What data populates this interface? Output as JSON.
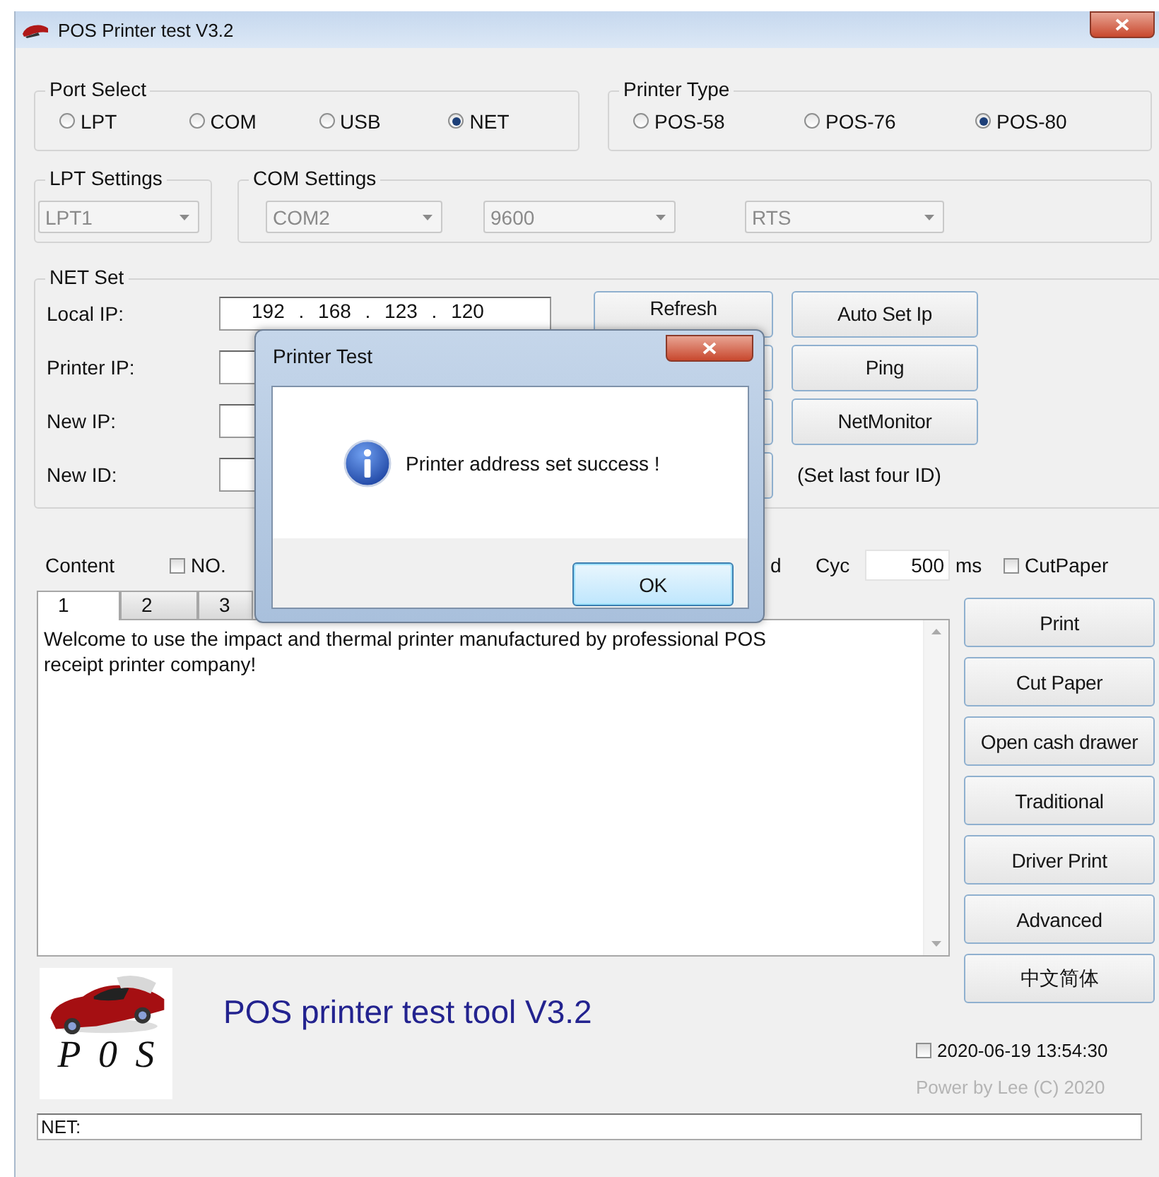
{
  "window": {
    "title": "POS Printer test V3.2"
  },
  "port_select": {
    "title": "Port Select",
    "options": [
      {
        "label": "LPT",
        "selected": false
      },
      {
        "label": "COM",
        "selected": false
      },
      {
        "label": "USB",
        "selected": false
      },
      {
        "label": "NET",
        "selected": true
      }
    ]
  },
  "printer_type": {
    "title": "Printer Type",
    "options": [
      {
        "label": "POS-58",
        "selected": false
      },
      {
        "label": "POS-76",
        "selected": false
      },
      {
        "label": "POS-80",
        "selected": true
      }
    ]
  },
  "lpt_settings": {
    "title": "LPT Settings",
    "fields": [
      {
        "value": "LPT1",
        "disabled": true
      }
    ]
  },
  "com_settings": {
    "title": "COM Settings",
    "fields": [
      {
        "value": "COM2",
        "disabled": true
      },
      {
        "value": "9600",
        "disabled": true
      },
      {
        "value": "RTS",
        "disabled": true
      }
    ]
  },
  "net_set": {
    "title": "NET Set",
    "rows": [
      {
        "label": "Local IP:",
        "value": "192 . 168 . 123 . 120",
        "button": "Refresh",
        "side_button": "Auto Set Ip"
      },
      {
        "label": "Printer IP:",
        "side_button": "Ping"
      },
      {
        "label": "New IP:",
        "side_button": "NetMonitor"
      },
      {
        "label": "New ID:",
        "note": "(Set last four ID)"
      }
    ]
  },
  "content": {
    "label": "Content",
    "number_checkbox": {
      "label": "NO.",
      "checked": false
    },
    "fragment": "d",
    "cycle_label": "Cyc",
    "cycle_value": "500",
    "unit": "ms",
    "cut_paper": {
      "label": "CutPaper",
      "checked": false
    }
  },
  "tabs": [
    {
      "label": "1",
      "selected": true
    },
    {
      "label": "2",
      "selected": false
    },
    {
      "label": "3",
      "selected": false
    }
  ],
  "text_area": {
    "value": "Welcome to use the impact and thermal printer manufactured by professional POS receipt printer company!"
  },
  "side_buttons": [
    "Print",
    "Cut Paper",
    "Open cash drawer",
    "Traditional",
    "Driver Print",
    "Advanced",
    "中文简体"
  ],
  "logo": {
    "text": "P 0 S"
  },
  "app_title": "POS printer test tool V3.2",
  "clock": {
    "label": "2020-06-19 13:54:30",
    "checked": false
  },
  "credit": "Power by Lee (C) 2020",
  "status_bar": {
    "value": "NET:"
  },
  "dialog": {
    "title": "Printer Test",
    "message": "Printer address set success !",
    "button": "OK"
  }
}
